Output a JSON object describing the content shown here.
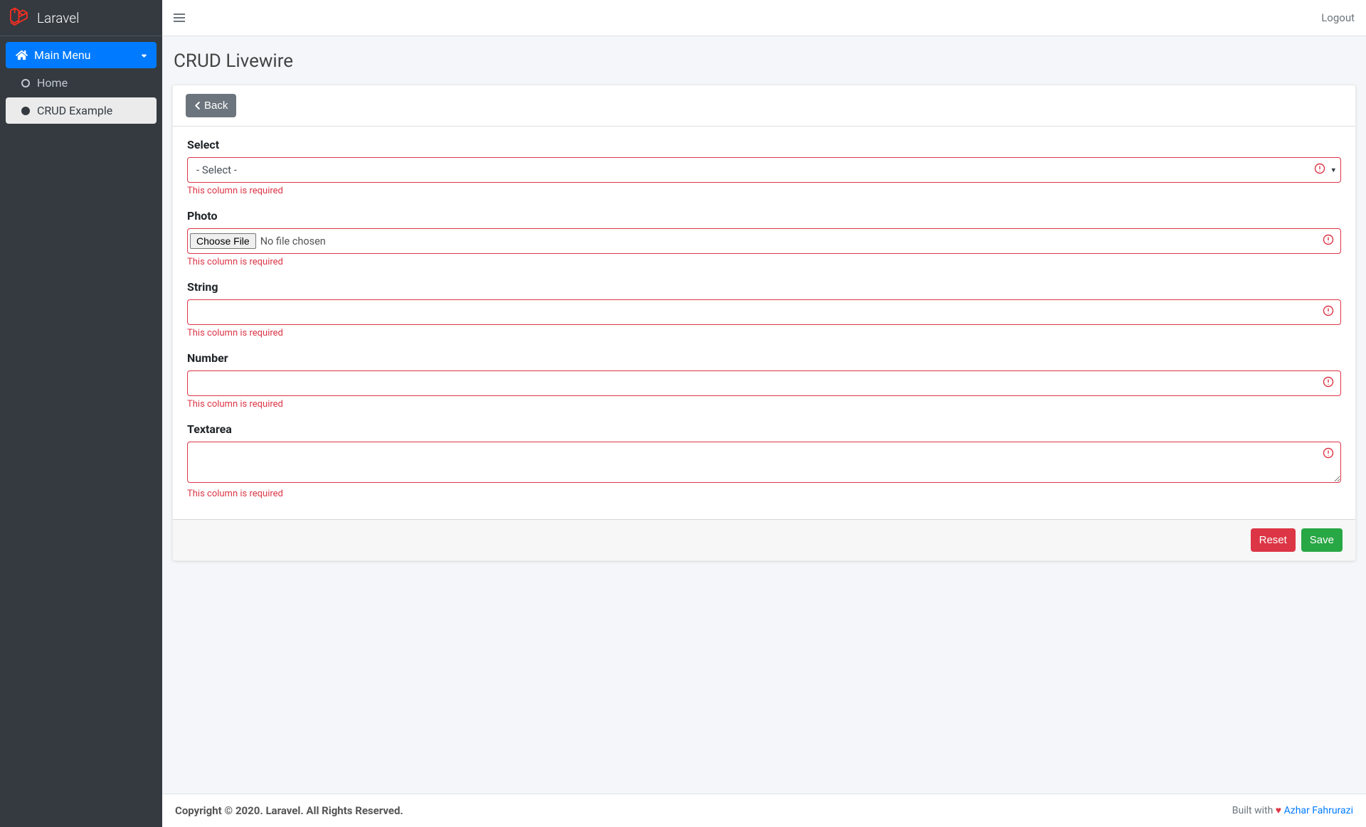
{
  "brand": {
    "name": "Laravel"
  },
  "sidebar": {
    "main_menu_label": "Main Menu",
    "items": [
      {
        "label": "Home"
      },
      {
        "label": "CRUD Example"
      }
    ]
  },
  "topbar": {
    "logout": "Logout"
  },
  "page": {
    "title": "CRUD Livewire"
  },
  "toolbar": {
    "back_label": "Back"
  },
  "form": {
    "error_required": "This column is required",
    "select": {
      "label": "Select",
      "placeholder": "- Select -"
    },
    "photo": {
      "label": "Photo",
      "choose_label": "Choose File",
      "no_file": "No file chosen"
    },
    "string": {
      "label": "String"
    },
    "number": {
      "label": "Number"
    },
    "textarea": {
      "label": "Textarea"
    }
  },
  "actions": {
    "reset": "Reset",
    "save": "Save"
  },
  "footer": {
    "copyright": "Copyright © 2020. Laravel. All Rights Reserved.",
    "built_with": "Built with ",
    "author": "Azhar Fahrurazi"
  }
}
